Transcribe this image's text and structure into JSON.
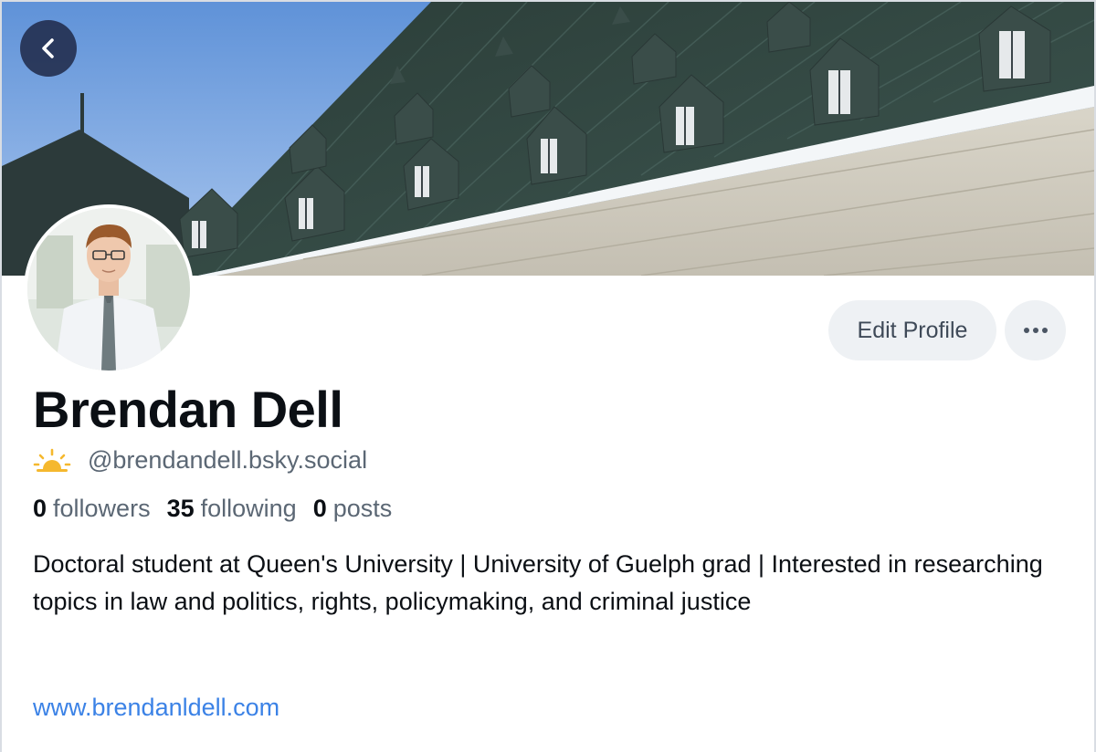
{
  "profile": {
    "display_name": "Brendan Dell",
    "handle": "@brendandell.bsky.social",
    "stats": {
      "followers_count": "0",
      "followers_label": "followers",
      "following_count": "35",
      "following_label": "following",
      "posts_count": "0",
      "posts_label": "posts"
    },
    "bio": "Doctoral student at Queen's University | University of Guelph grad | Interested in researching topics in law and politics, rights, policymaking, and criminal justice",
    "website": "www.brendanldell.com"
  },
  "actions": {
    "edit_label": "Edit Profile",
    "more_icon": "ellipsis-icon",
    "back_icon": "chevron-left-icon"
  },
  "colors": {
    "accent_link": "#3b82e6",
    "button_bg": "#eef1f4",
    "name_text": "#0b0f14",
    "muted_text": "#5b6774",
    "sun_icon": "#f5b82e"
  }
}
